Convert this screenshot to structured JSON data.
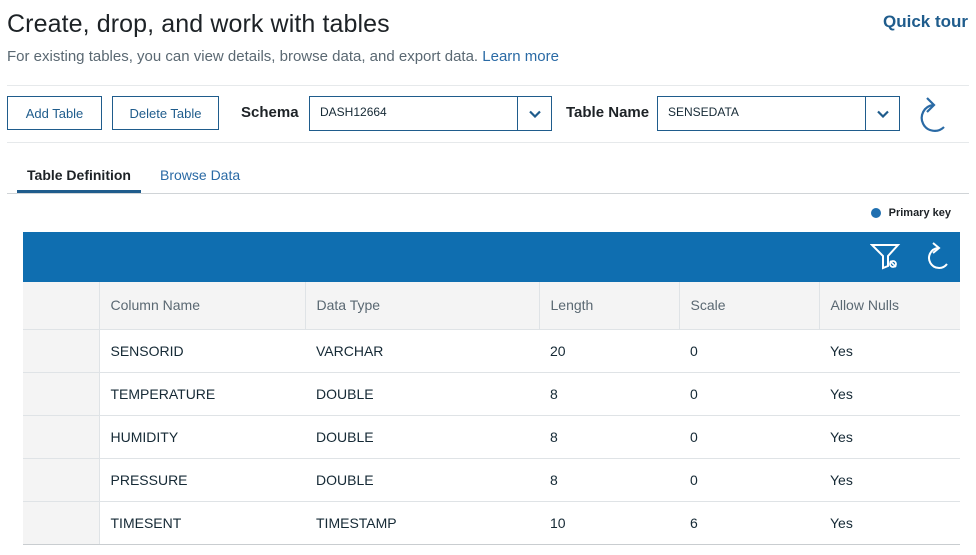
{
  "header": {
    "title": "Create, drop, and work with tables",
    "quick_tour": "Quick tour",
    "subtitle": "For existing tables, you can view details, browse data, and export data.",
    "learn_more": "Learn more"
  },
  "toolbar": {
    "add_table": "Add Table",
    "delete_table": "Delete Table",
    "schema_label": "Schema",
    "schema_value": "DASH12664",
    "table_name_label": "Table Name",
    "table_name_value": "SENSEDATA",
    "refresh_icon": "refresh-icon"
  },
  "tabs": [
    {
      "label": "Table Definition",
      "active": true
    },
    {
      "label": "Browse Data",
      "active": false
    }
  ],
  "legend": {
    "primary_key": "Primary key",
    "primary_key_color": "#1f6fb0"
  },
  "grid": {
    "toolbar_color": "#0f6eb0",
    "icons": [
      "filter-icon",
      "refresh-icon"
    ],
    "columns": [
      "Column Name",
      "Data Type",
      "Length",
      "Scale",
      "Allow Nulls"
    ],
    "rows": [
      [
        "SENSORID",
        "VARCHAR",
        "20",
        "0",
        "Yes"
      ],
      [
        "TEMPERATURE",
        "DOUBLE",
        "8",
        "0",
        "Yes"
      ],
      [
        "HUMIDITY",
        "DOUBLE",
        "8",
        "0",
        "Yes"
      ],
      [
        "PRESSURE",
        "DOUBLE",
        "8",
        "0",
        "Yes"
      ],
      [
        "TIMESENT",
        "TIMESTAMP",
        "10",
        "6",
        "Yes"
      ]
    ]
  }
}
